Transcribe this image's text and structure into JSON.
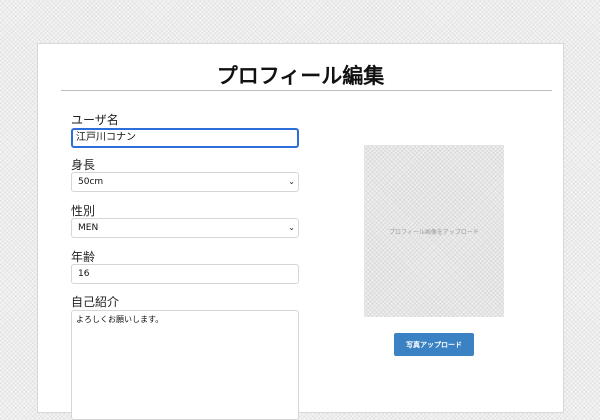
{
  "page": {
    "title": "プロフィール編集"
  },
  "form": {
    "username": {
      "label": "ユーザ名",
      "value": "江戸川コナン"
    },
    "height": {
      "label": "身長",
      "value": "50cm"
    },
    "gender": {
      "label": "性別",
      "value": "MEN"
    },
    "age": {
      "label": "年齢",
      "value": "16"
    },
    "bio": {
      "label": "自己紹介",
      "value": "よろしくお願いします。"
    }
  },
  "photo": {
    "placeholder": "プロフィール画像をアップロード",
    "upload_label": "写真アップロード",
    "button_color": "#3b82c4"
  },
  "icons": {
    "select_arrow": "chevron-down-icon"
  }
}
